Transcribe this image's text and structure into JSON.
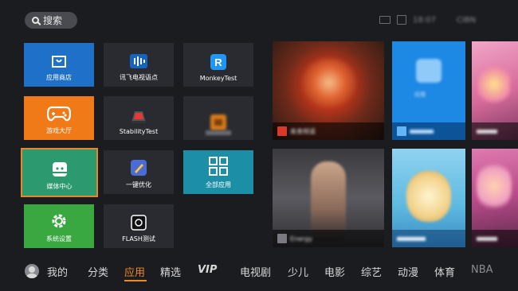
{
  "search": {
    "label": "搜索"
  },
  "status": {
    "time": "18:07",
    "extra": "CIBN"
  },
  "tiles": [
    {
      "label": "应用商店",
      "color": "#1f70c8"
    },
    {
      "label": "讯飞电视语点",
      "color": "#2a2b30"
    },
    {
      "label": "MonkeyTest",
      "color": "#2a2b30"
    },
    {
      "label": "游戏大厅",
      "color": "#f07a17"
    },
    {
      "label": "StabilityTest",
      "color": "#2a2b30"
    },
    {
      "label": "",
      "color": "#2a2b30"
    },
    {
      "label": "媒体中心",
      "color": "#2c9a6e"
    },
    {
      "label": "一键优化",
      "color": "#2a2b30"
    },
    {
      "label": "全部应用",
      "color": "#1c8fa6"
    },
    {
      "label": "系统设置",
      "color": "#3aa840"
    },
    {
      "label": "FLASH测试",
      "color": "#2a2b30"
    }
  ],
  "posters": [
    {
      "caption": "美食频道"
    },
    {
      "caption": "应用"
    },
    {
      "caption": ""
    },
    {
      "caption": "Energy"
    },
    {
      "caption": ""
    },
    {
      "caption": ""
    }
  ],
  "nav": {
    "profile": "我的",
    "items": [
      "分类",
      "应用",
      "精选",
      "VIP",
      "电视剧",
      "少儿",
      "电影",
      "综艺",
      "动漫",
      "体育",
      "NBA"
    ],
    "active": "应用"
  }
}
